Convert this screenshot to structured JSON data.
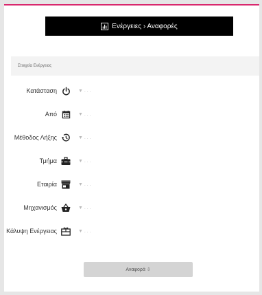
{
  "header": {
    "title": "Ενέργειες › Αναφορές",
    "icon": "bar-chart-icon"
  },
  "section": {
    "title": "Στοιχεία Ενέργειας"
  },
  "fields": [
    {
      "label": "Κατάσταση",
      "icon": "power-icon",
      "value": "▼ . . ."
    },
    {
      "label": "Από",
      "icon": "calendar-icon",
      "value": "▼ . . ."
    },
    {
      "label": "Μέθοδος Λήξης",
      "icon": "history-icon",
      "value": "▼ . . ."
    },
    {
      "label": "Τμήμα",
      "icon": "toolbox-icon",
      "value": "▼ . . ."
    },
    {
      "label": "Εταιρία",
      "icon": "store-icon",
      "value": "▼ . . ."
    },
    {
      "label": "Μηχανισμός",
      "icon": "basket-icon",
      "value": "▼ . . ."
    },
    {
      "label": "Κάλυψη Ενέργειας",
      "icon": "gift-card-icon",
      "value": "▼ . . ."
    }
  ],
  "report_button": {
    "label": "Αναφορά ⇩"
  },
  "colors": {
    "accent": "#d9286e",
    "header_bg": "#000000",
    "button_bg": "#d4d4d4"
  }
}
